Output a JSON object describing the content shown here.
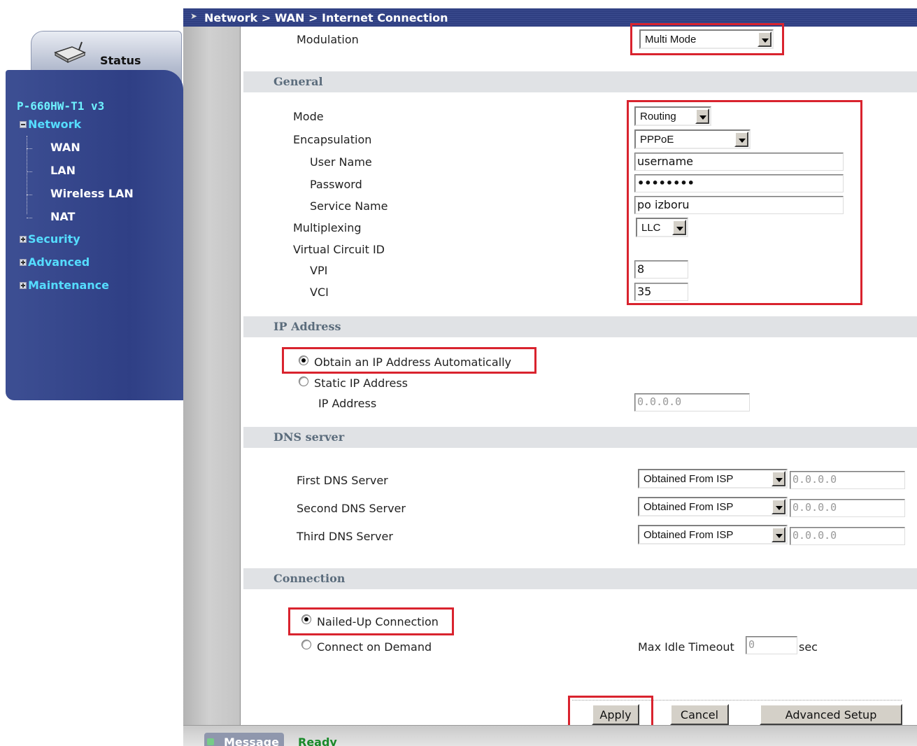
{
  "sidebar": {
    "status_label": "Status",
    "model": "P-660HW-T1 v3",
    "nav": {
      "network": "Network",
      "wan": "WAN",
      "lan": "LAN",
      "wireless_lan": "Wireless LAN",
      "nat": "NAT",
      "security": "Security",
      "advanced": "Advanced",
      "maintenance": "Maintenance"
    }
  },
  "breadcrumb": "Network > WAN > Internet Connection",
  "modulation": {
    "label": "Modulation",
    "value": "Multi Mode"
  },
  "general": {
    "title": "General",
    "mode": {
      "label": "Mode",
      "value": "Routing"
    },
    "encapsulation": {
      "label": "Encapsulation",
      "value": "PPPoE"
    },
    "user_name": {
      "label": "User Name",
      "value": "username"
    },
    "password": {
      "label": "Password",
      "value": "••••••••"
    },
    "service_name": {
      "label": "Service Name",
      "value": "po izboru"
    },
    "multiplexing": {
      "label": "Multiplexing",
      "value": "LLC"
    },
    "virtual_circuit": {
      "label": "Virtual Circuit ID"
    },
    "vpi": {
      "label": "VPI",
      "value": "8"
    },
    "vci": {
      "label": "VCI",
      "value": "35"
    }
  },
  "ip_address": {
    "title": "IP Address",
    "obtain_auto": "Obtain an IP Address Automatically",
    "static": "Static IP Address",
    "ip_label": "IP Address",
    "ip_value": "0.0.0.0"
  },
  "dns": {
    "title": "DNS server",
    "first": {
      "label": "First DNS Server",
      "mode": "Obtained From ISP",
      "value": "0.0.0.0"
    },
    "second": {
      "label": "Second DNS Server",
      "mode": "Obtained From ISP",
      "value": "0.0.0.0"
    },
    "third": {
      "label": "Third DNS Server",
      "mode": "Obtained From ISP",
      "value": "0.0.0.0"
    }
  },
  "connection": {
    "title": "Connection",
    "nailed_up": "Nailed-Up Connection",
    "on_demand": "Connect on Demand",
    "max_idle_label": "Max Idle Timeout",
    "max_idle_value": "0",
    "max_idle_unit": "sec"
  },
  "buttons": {
    "apply": "Apply",
    "cancel": "Cancel",
    "advanced_setup": "Advanced Setup"
  },
  "message_bar": {
    "label": "Message",
    "status": "Ready"
  },
  "colors": {
    "nav_bg": "#33448a",
    "highlight": "#d9232e",
    "section_bg": "#e0e2e5",
    "ready": "#1a8a2a"
  }
}
